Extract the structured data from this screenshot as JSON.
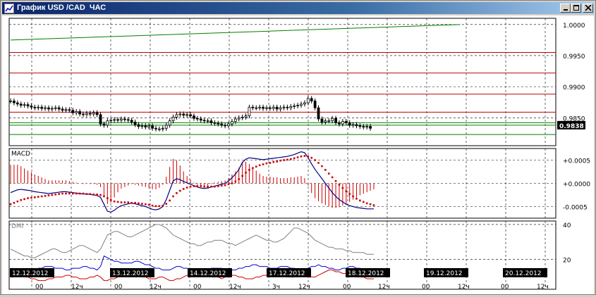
{
  "window": {
    "title": "График USD /CAD  ЧАС",
    "icon": "chart-icon",
    "controls": [
      "minimize-icon",
      "maximize-icon",
      "close-icon"
    ]
  },
  "colors": {
    "background": "#ffffff",
    "grid": "#000000",
    "price_bars": "#000000",
    "trend_line": "#008000",
    "level_lines": "#c00000",
    "macd_line": "#000080",
    "signal_dots": "#cc0000",
    "histogram": "#cc0000",
    "dmi_adx": "#808080",
    "dmi_plus": "#0000cc",
    "dmi_minus": "#cc0000",
    "price_label_bg": "#000000",
    "date_label_bg": "#000000"
  },
  "chart_data": [
    {
      "type": "candlestick",
      "panel": "price",
      "ylim": [
        0.9805,
        1.001
      ],
      "y_ticks": [
        "1.0000",
        "0.9950",
        "0.9900",
        "0.9850"
      ],
      "current_price": "0.9838",
      "trend_line": {
        "x": [
          0,
          130
        ],
        "y": [
          0.9975,
          1.0
        ]
      },
      "horizontal_levels": {
        "red": [
          0.9955,
          0.9922,
          0.9888,
          0.9859
        ],
        "green": [
          0.9842,
          0.9838,
          0.9823
        ]
      },
      "closes": [
        0.9877,
        0.9874,
        0.9872,
        0.987,
        0.9871,
        0.9869,
        0.9867,
        0.9866,
        0.9867,
        0.9865,
        0.9866,
        0.9864,
        0.9865,
        0.9866,
        0.9864,
        0.9862,
        0.9863,
        0.9862,
        0.9858,
        0.986,
        0.9856,
        0.9855,
        0.9857,
        0.9856,
        0.9858,
        0.9855,
        0.984,
        0.9838,
        0.9845,
        0.9846,
        0.9847,
        0.9846,
        0.9848,
        0.9847,
        0.9846,
        0.9843,
        0.9839,
        0.9836,
        0.9837,
        0.9835,
        0.9837,
        0.9833,
        0.9832,
        0.9832,
        0.9833,
        0.9838,
        0.9845,
        0.9851,
        0.9855,
        0.9856,
        0.9854,
        0.9855,
        0.9853,
        0.9849,
        0.9848,
        0.9846,
        0.9845,
        0.9845,
        0.9842,
        0.9841,
        0.984,
        0.9838,
        0.9837,
        0.984,
        0.9844,
        0.9848,
        0.985,
        0.9851,
        0.9853,
        0.9867,
        0.9866,
        0.9866,
        0.9867,
        0.9865,
        0.9866,
        0.9865,
        0.9867,
        0.9864,
        0.9866,
        0.9867,
        0.9866,
        0.9868,
        0.9869,
        0.987,
        0.9872,
        0.9874,
        0.9881,
        0.9877,
        0.9866,
        0.9848,
        0.9843,
        0.9845,
        0.9845,
        0.9849,
        0.9842,
        0.984,
        0.9844,
        0.9842,
        0.9838,
        0.9839,
        0.9837,
        0.9836,
        0.9835,
        0.9836,
        0.9833
      ]
    },
    {
      "type": "line",
      "panel": "macd",
      "title": "MACD",
      "ylim": [
        -0.00075,
        0.00075
      ],
      "y_ticks": [
        "+0.0005",
        "+0.0000",
        "-0.0005"
      ],
      "series": [
        {
          "values": [
            -0.0002,
            -0.00017,
            -0.00014,
            -0.00013,
            -0.00014,
            -0.00015,
            -0.00016,
            -0.00018,
            -0.00019,
            -0.0002,
            -0.00021,
            -0.00022,
            -0.00021,
            -0.0002,
            -0.00019,
            -0.00018,
            -0.00018,
            -0.00019,
            -0.0002,
            -0.00021,
            -0.00022,
            -0.00023,
            -0.00023,
            -0.00024,
            -0.00025,
            -0.00026,
            -0.0003,
            -0.00045,
            -0.0006,
            -0.00062,
            -0.00058,
            -0.00052,
            -0.00048,
            -0.00046,
            -0.00044,
            -0.00043,
            -0.00044,
            -0.00046,
            -0.00048,
            -0.0005,
            -0.00053,
            -0.00056,
            -0.00057,
            -0.00055,
            -0.0005,
            -0.00035,
            -0.00015,
            5e-05,
            0.0001,
            8e-05,
            4e-05,
            1e-05,
            -2e-05,
            -5e-05,
            -8e-05,
            -0.0001,
            -0.00011,
            -0.0001,
            -8e-05,
            -6e-05,
            -4e-05,
            -2e-05,
            0.0,
            5e-05,
            0.00012,
            0.0002,
            0.0003,
            0.00045,
            0.00052,
            0.00055,
            0.00054,
            0.00053,
            0.00052,
            0.00051,
            0.00052,
            0.00053,
            0.00054,
            0.00055,
            0.00056,
            0.00057,
            0.00058,
            0.0006,
            0.00062,
            0.00065,
            0.00068,
            0.00066,
            0.00055,
            0.00042,
            0.0003,
            0.0002,
            0.0001,
            0.0,
            -0.0001,
            -0.0002,
            -0.00028,
            -0.00035,
            -0.0004,
            -0.00045,
            -0.00048,
            -0.0005,
            -0.00052,
            -0.00053,
            -0.00054,
            -0.00055,
            -0.00055,
            -0.00055
          ]
        },
        {
          "values": [
            -0.00045,
            -0.00042,
            -0.00039,
            -0.00036,
            -0.00034,
            -0.00032,
            -0.00031,
            -0.0003,
            -0.00029,
            -0.00028,
            -0.00027,
            -0.00026,
            -0.00025,
            -0.00024,
            -0.00023,
            -0.00022,
            -0.00022,
            -0.00022,
            -0.00022,
            -0.00022,
            -0.00022,
            -0.00022,
            -0.00023,
            -0.00023,
            -0.00024,
            -0.00024,
            -0.00025,
            -0.00028,
            -0.00032,
            -0.00036,
            -0.00039,
            -0.0004,
            -0.00041,
            -0.00041,
            -0.00041,
            -0.00042,
            -0.00042,
            -0.00043,
            -0.00044,
            -0.00045,
            -0.00046,
            -0.00048,
            -0.00049,
            -0.00049,
            -0.00048,
            -0.00044,
            -0.00037,
            -0.00028,
            -0.00021,
            -0.00016,
            -0.00012,
            -9e-05,
            -7e-05,
            -6e-05,
            -6e-05,
            -6e-05,
            -7e-05,
            -7e-05,
            -7e-05,
            -7e-05,
            -6e-05,
            -5e-05,
            -4e-05,
            -2e-05,
            0.0,
            4e-05,
            9e-05,
            0.00016,
            0.00023,
            0.00029,
            0.00033,
            0.00036,
            0.00039,
            0.00041,
            0.00043,
            0.00044,
            0.00046,
            0.00047,
            0.00049,
            0.0005,
            0.00051,
            0.00052,
            0.00054,
            0.00056,
            0.00058,
            0.00059,
            0.00058,
            0.00055,
            0.0005,
            0.00044,
            0.00037,
            0.00029,
            0.00021,
            0.00013,
            5e-05,
            -3e-05,
            -0.0001,
            -0.00017,
            -0.00023,
            -0.00028,
            -0.00033,
            -0.00037,
            -0.0004,
            -0.00043,
            -0.00045,
            -0.00047
          ]
        }
      ]
    },
    {
      "type": "line",
      "panel": "dmi",
      "title": "DMI",
      "ylim": [
        3,
        42
      ],
      "y_ticks": [
        "40",
        "20"
      ],
      "series": [
        {
          "values": [
            26,
            25,
            24,
            23,
            22,
            22,
            21,
            21,
            22,
            23,
            24,
            25,
            26,
            26,
            25,
            24,
            24,
            25,
            26,
            27,
            28,
            28,
            27,
            26,
            25,
            24,
            26,
            30,
            34,
            35,
            36,
            36,
            35,
            34,
            33,
            33,
            34,
            35,
            36,
            37,
            38,
            39,
            40,
            40,
            39,
            38,
            36,
            34,
            33,
            32,
            31,
            30,
            29,
            29,
            28,
            28,
            29,
            30,
            30,
            31,
            31,
            31,
            30,
            29,
            29,
            28,
            29,
            30,
            31,
            32,
            33,
            34,
            33,
            32,
            31,
            31,
            30,
            30,
            31,
            32,
            34,
            36,
            38,
            38,
            37,
            36,
            35,
            33,
            31,
            30,
            29,
            28,
            27,
            27,
            26,
            26,
            26,
            25,
            25,
            24,
            24,
            24,
            24,
            23,
            23,
            23
          ]
        },
        {
          "values": [
            15,
            14,
            14,
            13,
            13,
            13,
            14,
            14,
            15,
            15,
            16,
            16,
            16,
            15,
            15,
            15,
            14,
            14,
            15,
            15,
            15,
            16,
            16,
            15,
            15,
            14,
            16,
            22,
            21,
            20,
            19,
            19,
            18,
            18,
            18,
            18,
            19,
            19,
            18,
            17,
            17,
            16,
            15,
            15,
            14,
            14,
            14,
            15,
            16,
            16,
            15,
            15,
            14,
            14,
            13,
            13,
            14,
            14,
            15,
            15,
            15,
            15,
            14,
            14,
            14,
            14,
            15,
            15,
            16,
            16,
            17,
            17,
            16,
            16,
            16,
            15,
            15,
            15,
            16,
            16,
            16,
            15,
            15,
            14,
            14,
            14,
            15,
            16,
            16,
            17,
            16,
            16,
            15,
            15,
            14,
            14,
            15,
            15,
            16,
            16,
            15,
            15,
            14,
            14,
            14,
            14
          ]
        },
        {
          "values": [
            10,
            10,
            11,
            11,
            10,
            10,
            9,
            9,
            8,
            8,
            8,
            9,
            9,
            10,
            10,
            10,
            11,
            11,
            10,
            10,
            9,
            9,
            9,
            10,
            10,
            11,
            10,
            8,
            8,
            9,
            9,
            10,
            11,
            11,
            12,
            12,
            11,
            11,
            10,
            10,
            9,
            9,
            9,
            10,
            10,
            9,
            8,
            8,
            9,
            9,
            10,
            11,
            11,
            12,
            12,
            12,
            11,
            11,
            10,
            10,
            10,
            9,
            10,
            10,
            11,
            11,
            10,
            10,
            9,
            9,
            9,
            10,
            10,
            11,
            11,
            11,
            12,
            12,
            11,
            11,
            10,
            10,
            10,
            11,
            11,
            11,
            10,
            10,
            10,
            11,
            12,
            13,
            14,
            14,
            13,
            13,
            12,
            12,
            11,
            11,
            10,
            10,
            10,
            9,
            9,
            9
          ]
        }
      ]
    }
  ],
  "time_axis": {
    "date_labels": [
      "12.12.2012",
      "13.12.2012",
      "14.12.2012",
      "17.12.2012",
      "18.12.2012",
      "19.12.2012",
      "20.12.2012"
    ],
    "hour_labels": [
      "00",
      "12ч",
      "00",
      "12ч",
      "00",
      "12ч",
      "3ч",
      "12ч",
      "00",
      "12ч",
      "00",
      "12ч",
      "00",
      "12ч"
    ]
  }
}
